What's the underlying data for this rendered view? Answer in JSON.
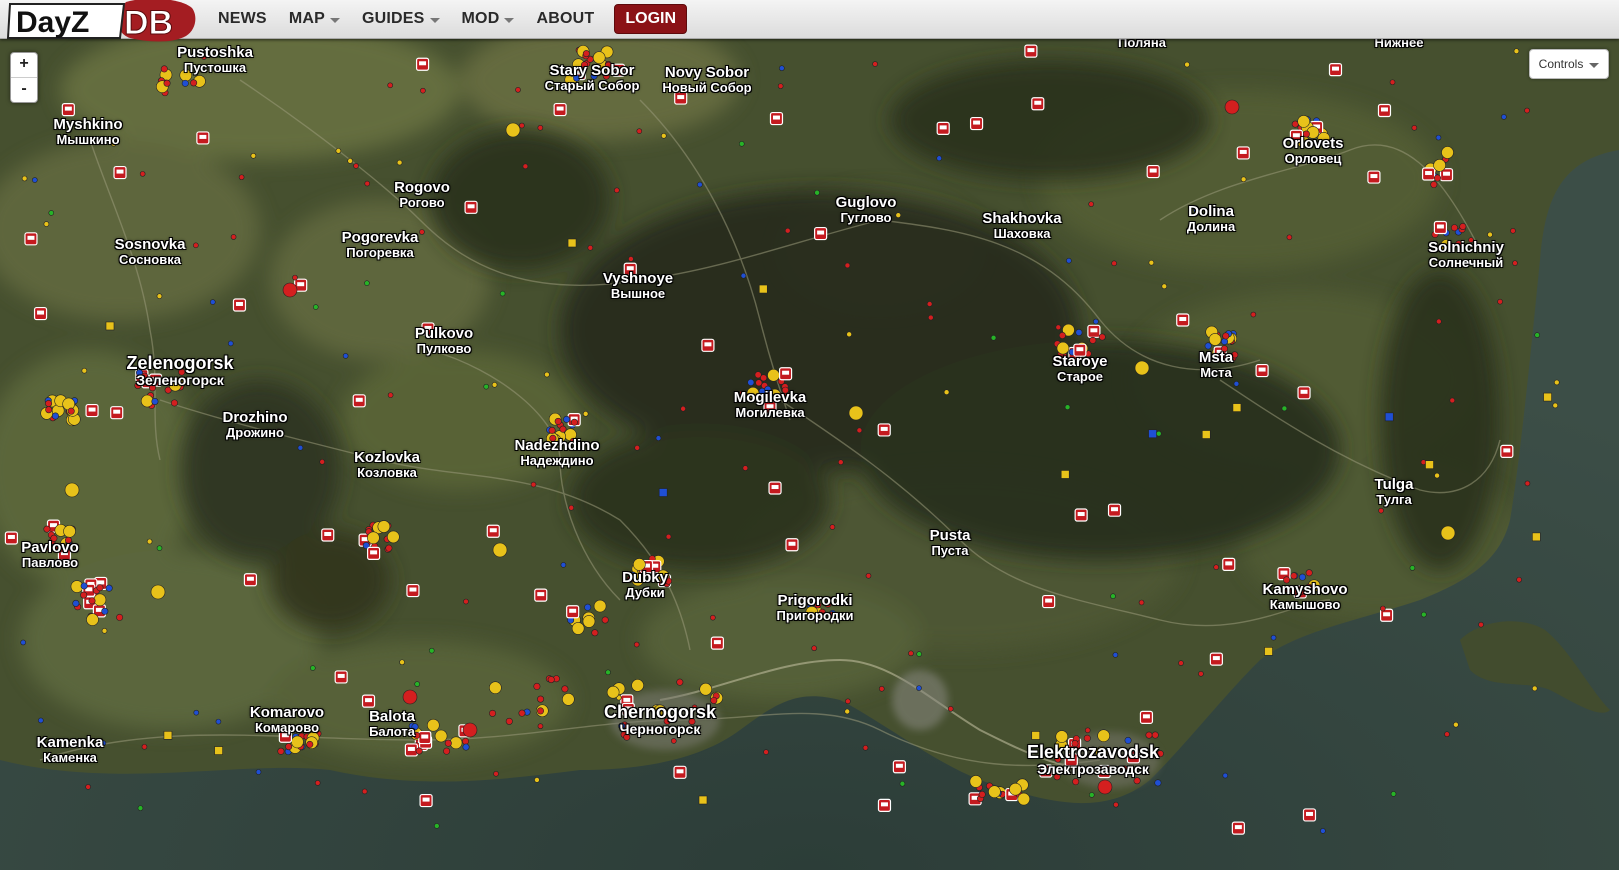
{
  "nav": {
    "logo_text_left": "DayZ",
    "logo_text_right": "DB",
    "items": [
      {
        "label": "NEWS",
        "dropdown": false
      },
      {
        "label": "MAP",
        "dropdown": true
      },
      {
        "label": "GUIDES",
        "dropdown": true
      },
      {
        "label": "MOD",
        "dropdown": true
      },
      {
        "label": "ABOUT",
        "dropdown": false
      }
    ],
    "login_label": "LOGIN"
  },
  "map_controls": {
    "zoom_in": "+",
    "zoom_out": "-",
    "controls_label": "Controls"
  },
  "towns": [
    {
      "en": "Pustoshka",
      "ru": "Пустошка"
    },
    {
      "en": "Stary Sobor",
      "ru": "Старый Собор"
    },
    {
      "en": "Novy Sobor",
      "ru": "Новый Собор"
    },
    {
      "en": "",
      "ru": "Поляна"
    },
    {
      "en": "",
      "ru": "Нижнее"
    },
    {
      "en": "Myshkino",
      "ru": "Мышкино"
    },
    {
      "en": "Orlovets",
      "ru": "Орловец"
    },
    {
      "en": "Rogovo",
      "ru": "Рогово"
    },
    {
      "en": "Guglovo",
      "ru": "Гуглово"
    },
    {
      "en": "Shakhovka",
      "ru": "Шаховка"
    },
    {
      "en": "Dolina",
      "ru": "Долина"
    },
    {
      "en": "Sosnovka",
      "ru": "Сосновка"
    },
    {
      "en": "Pogorevka",
      "ru": "Погоревка"
    },
    {
      "en": "Solnichniy",
      "ru": "Солнечный"
    },
    {
      "en": "Vyshnoye",
      "ru": "Вышное"
    },
    {
      "en": "Pulkovo",
      "ru": "Пулково"
    },
    {
      "en": "Zelenogorsk",
      "ru": "Зеленогорск"
    },
    {
      "en": "Staroye",
      "ru": "Старое"
    },
    {
      "en": "Msta",
      "ru": "Мста"
    },
    {
      "en": "Mogilevka",
      "ru": "Могилевка"
    },
    {
      "en": "Drozhino",
      "ru": "Дрожино"
    },
    {
      "en": "Nadezhdino",
      "ru": "Надеждино"
    },
    {
      "en": "Kozlovka",
      "ru": "Козловка"
    },
    {
      "en": "Tulga",
      "ru": "Тулга"
    },
    {
      "en": "Pusta",
      "ru": "Пуста"
    },
    {
      "en": "Pavlovo",
      "ru": "Павлово"
    },
    {
      "en": "Dubky",
      "ru": "Дубки"
    },
    {
      "en": "Kamyshovo",
      "ru": "Камышово"
    },
    {
      "en": "Prigorodki",
      "ru": "Пригородки"
    },
    {
      "en": "Komarovo",
      "ru": "Комарово"
    },
    {
      "en": "Balota",
      "ru": "Балота"
    },
    {
      "en": "Chernogorsk",
      "ru": "Черногорск"
    },
    {
      "en": "Kamenka",
      "ru": "Каменка"
    },
    {
      "en": "Elektrozavodsk",
      "ru": "Электрозаводск"
    }
  ],
  "colors": {
    "login_bg": "#8b1216",
    "marker_red": "#d41f1f",
    "marker_yellow": "#e8c21a",
    "marker_blue": "#1f4fd4",
    "marker_green": "#27b327",
    "sea": "#34453f",
    "land": "#4a5433"
  },
  "icons": {
    "vehicle_marker": "car-icon",
    "medical_marker": "medical-cross-icon",
    "loot_marker": "loot-square-icon"
  }
}
